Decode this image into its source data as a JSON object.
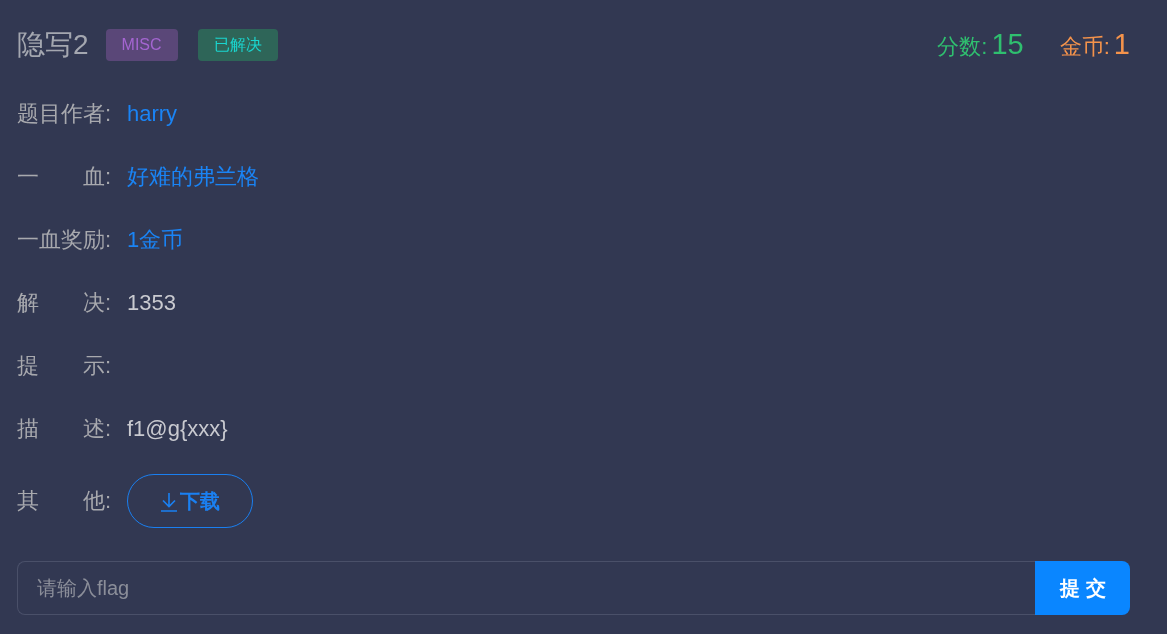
{
  "challenge": {
    "title": "隐写2",
    "tags": [
      {
        "label": "MISC",
        "color": "#5a4778"
      },
      {
        "label": "已解决",
        "color": "#2e6558"
      }
    ]
  },
  "stats": [
    {
      "label": "分数:",
      "value": "15",
      "color": "#2fbf6f"
    },
    {
      "label": "金币:",
      "value": "1",
      "color": "#f5934b"
    }
  ],
  "fields": [
    {
      "label": "题目作者:",
      "kind": "link",
      "value": "harry"
    },
    {
      "label": "一　　血:",
      "kind": "link",
      "value": "好难的弗兰格"
    },
    {
      "label": "一血奖励:",
      "kind": "link",
      "value": "1金币"
    },
    {
      "label": "解　　决:",
      "kind": "text",
      "value": "1353"
    },
    {
      "label": "提　　示:",
      "kind": "text"
    },
    {
      "label": "描　　述:",
      "kind": "text",
      "value": "f1@g{xxx}"
    },
    {
      "label": "其　　他:",
      "kind": "button",
      "value": "下载"
    }
  ],
  "flag_form": {
    "placeholder": "请输入flag",
    "submit_label": "提交"
  }
}
